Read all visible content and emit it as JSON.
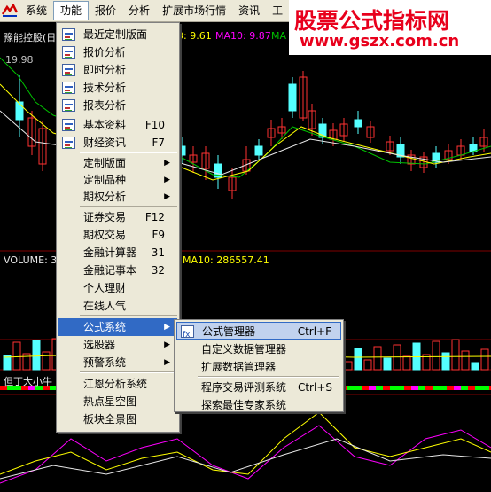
{
  "menubar": {
    "items": [
      {
        "label": "系统"
      },
      {
        "label": "功能"
      },
      {
        "label": "报价"
      },
      {
        "label": "分析"
      },
      {
        "label": "扩展市场行情"
      },
      {
        "label": "资讯"
      },
      {
        "label": "工"
      }
    ]
  },
  "watermark": {
    "line1": "股票公式指标网",
    "line2": "www.gszx.com.cn"
  },
  "chart": {
    "stock_title": "豫能控股(日",
    "ma_values": {
      "a": "3: 9.61",
      "ma10": "MA10: 9.87",
      "tail": "MA"
    },
    "price_label": "19.98",
    "volume": {
      "prefix": "VOLUME: 3",
      "ma10": "MA10: 286557.41"
    },
    "indicator_label": "但丁大小牛",
    "colors": {
      "up": "#ff3232",
      "down": "#54ffff",
      "ma_yellow": "#ffff00",
      "ma_green": "#00c000",
      "ma_white": "#e8e8e8",
      "magenta": "#ff00ff",
      "volume_ma": "#ffff00"
    }
  },
  "menu": {
    "items": [
      {
        "label": "最近定制版面",
        "icon": "layout-icon"
      },
      {
        "label": "报价分析",
        "icon": "quote-icon"
      },
      {
        "label": "即时分析",
        "icon": "line-chart-icon"
      },
      {
        "label": "技术分析",
        "icon": "candlestick-icon"
      },
      {
        "label": "报表分析",
        "icon": "report-icon"
      },
      {
        "label": "基本资料",
        "shortcut": "F10",
        "icon": "f10-icon"
      },
      {
        "label": "财经资讯",
        "shortcut": "F7",
        "icon": "news-icon"
      },
      {
        "label": "定制版面"
      },
      {
        "label": "定制品种"
      },
      {
        "label": "期权分析"
      },
      {
        "label": "证券交易",
        "shortcut": "F12"
      },
      {
        "label": "期权交易",
        "shortcut": "F9"
      },
      {
        "label": "金融计算器",
        "shortcut": "31"
      },
      {
        "label": "金融记事本",
        "shortcut": "32"
      },
      {
        "label": "个人理财"
      },
      {
        "label": "在线人气"
      },
      {
        "label": "公式系统"
      },
      {
        "label": "选股器"
      },
      {
        "label": "预警系统"
      },
      {
        "label": "江恩分析系统"
      },
      {
        "label": "热点星空图"
      },
      {
        "label": "板块全景图"
      }
    ]
  },
  "submenu": {
    "items": [
      {
        "label": "公式管理器",
        "shortcut": "Ctrl+F",
        "icon": "formula-icon"
      },
      {
        "label": "自定义数据管理器"
      },
      {
        "label": "扩展数据管理器"
      },
      {
        "label": "程序交易评测系统",
        "shortcut": "Ctrl+S"
      },
      {
        "label": "探索最佳专家系统"
      }
    ]
  }
}
